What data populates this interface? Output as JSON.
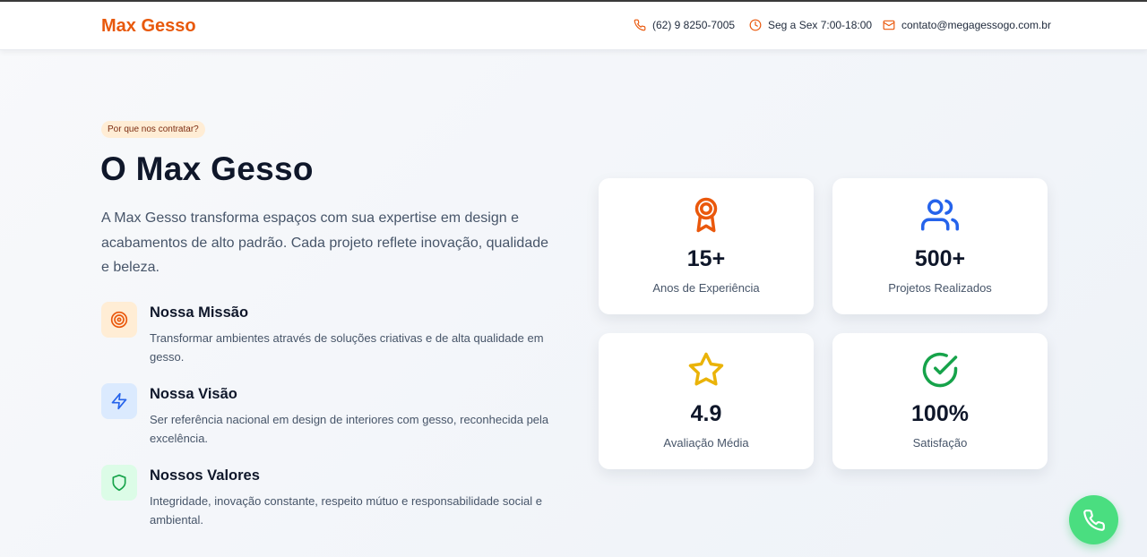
{
  "header": {
    "brand": "Max Gesso",
    "phone": "(62) 9 8250-7005",
    "hours": "Seg a Sex 7:00-18:00",
    "email": "contato@megagessogo.com.br"
  },
  "about": {
    "badge": "Por que nos contratar?",
    "title": "O Max Gesso",
    "lead": "A Max Gesso transforma espaços com sua expertise em design e acabamentos de alto padrão. Cada projeto reflete inovação, qualidade e beleza.",
    "features": [
      {
        "icon": "target-icon",
        "title": "Nossa Missão",
        "text": "Transformar ambientes através de soluções criativas e de alta qualidade em gesso."
      },
      {
        "icon": "lightning-icon",
        "title": "Nossa Visão",
        "text": "Ser referência nacional em design de interiores com gesso, reconhecida pela excelência."
      },
      {
        "icon": "shield-icon",
        "title": "Nossos Valores",
        "text": "Integridade, inovação constante, respeito mútuo e responsabilidade social e ambiental."
      }
    ]
  },
  "stats": [
    {
      "icon": "award-icon",
      "value": "15+",
      "label": "Anos de Experiência",
      "color": "#ea580c"
    },
    {
      "icon": "users-icon",
      "value": "500+",
      "label": "Projetos Realizados",
      "color": "#2563eb"
    },
    {
      "icon": "star-icon",
      "value": "4.9",
      "label": "Avaliação Média",
      "color": "#eab308"
    },
    {
      "icon": "check-circle-icon",
      "value": "100%",
      "label": "Satisfação",
      "color": "#16a34a"
    }
  ],
  "colors": {
    "brand": "#e8590c",
    "whatsapp": "#4ade80"
  },
  "fab": {
    "icon": "phone-icon"
  }
}
